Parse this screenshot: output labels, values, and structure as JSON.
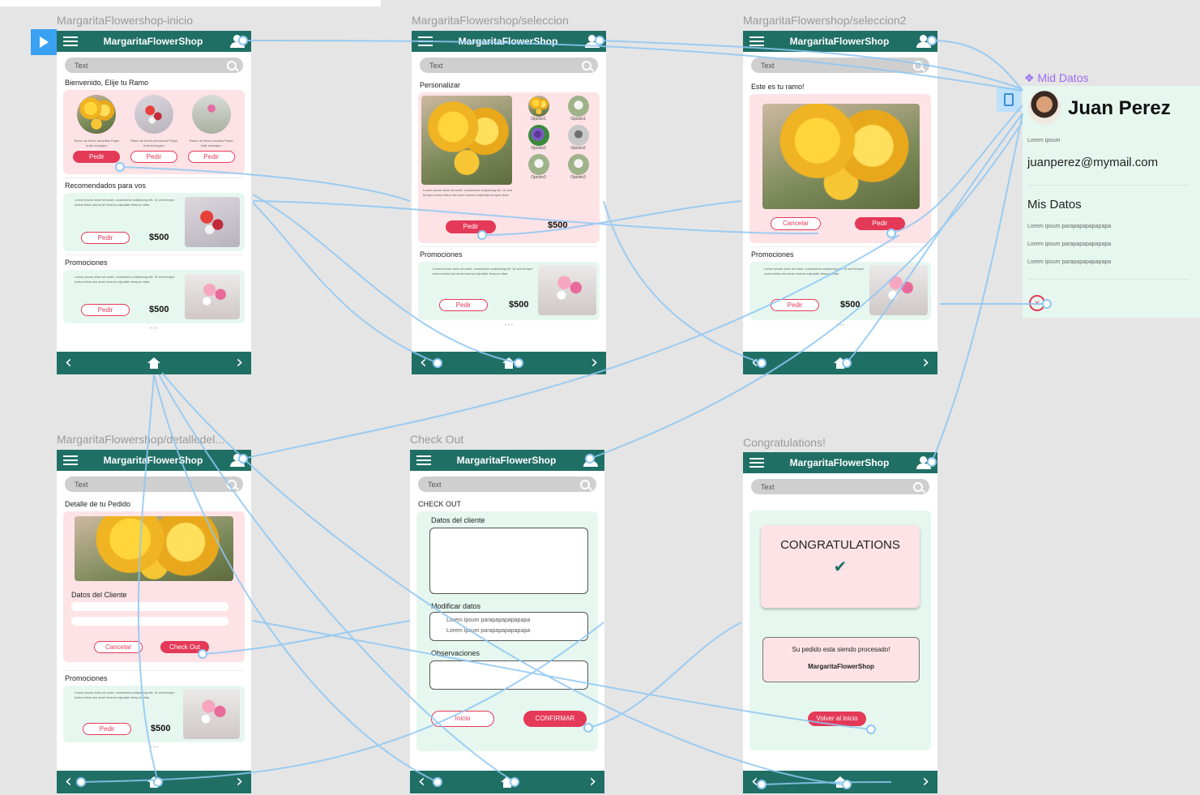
{
  "canvas": {
    "frames": [
      {
        "id": "inicio",
        "title": "MargaritaFlowershop-inicio"
      },
      {
        "id": "seleccion",
        "title": "MargaritaFlowershop/seleccion"
      },
      {
        "id": "seleccion2",
        "title": "MargaritaFlowershop/seleccion2"
      },
      {
        "id": "detalle",
        "title": "MargaritaFlowershop/detalledel..."
      },
      {
        "id": "checkout",
        "title": "Check Out"
      },
      {
        "id": "congrats",
        "title": "Congratulations!"
      }
    ],
    "component_label": "Mid Datos"
  },
  "app": {
    "brand": "MargaritaFlowerShop",
    "search_placeholder": "Text",
    "pedir": "Pedir",
    "price": "$500",
    "lorem_card": "Lorem ipsum dolor sit amet, consectetur adipiscing elit. Ut sed tempor luctus tellus nisl amet viverra vulputate tempus vitae.",
    "promociones": "Promociones"
  },
  "inicio": {
    "welcome": "Bienvenido, Elije tu Ramo",
    "products": [
      {
        "caption": "Ramo de flores amarillas Papel kraft ecologico",
        "button": "Pedir"
      },
      {
        "caption": "Ramo de flores primaveral Papel kraft ecologico",
        "button": "Pedir"
      },
      {
        "caption": "Ramo de flores rosadas Papel kraft ecologico",
        "button": "Pedir"
      }
    ],
    "recommended_title": "Recomendados para vos"
  },
  "seleccion": {
    "title": "Personalizar",
    "options": [
      "Opcion1",
      "Opcion1",
      "Opcion2",
      "Opcion2",
      "Opcion3",
      "Opcion3"
    ],
    "price": "$500"
  },
  "seleccion2": {
    "title": "Este es tu ramo!",
    "cancel": "Cancelar",
    "confirm": "Pedir"
  },
  "detalle": {
    "title": "Detalle de tu Pedido",
    "client_label": "Datos del Cliente",
    "cancel": "Cancelar",
    "checkout": "Check Out"
  },
  "checkout": {
    "title": "CHECK OUT",
    "client_label": "Datos del cliente",
    "modify_label": "Modificar datos",
    "modify_lines": [
      "Lorem ipsum parapapapapapapa",
      "Lorem ipsum parapapapapapapa"
    ],
    "obs_label": "Observaciones",
    "home": "Inicio",
    "confirm": "CONFIRMAR"
  },
  "congrats": {
    "heading": "CONGRATULATIONS",
    "processing": "Su pedido esta siendo procesado!",
    "brand": "MargaritaFlowerShop",
    "back": "Volver al inicio"
  },
  "profile": {
    "name": "Juan Perez",
    "subtitle": "Lorem ipsum",
    "email": "juanperez@mymail.com",
    "section": "Mis Datos",
    "lines": [
      "Lorem ipsum parapapapapapapa",
      "Lorem ipsum parapapapapapapa",
      "Lorem ipsum parapapapapapapa"
    ]
  },
  "colors": {
    "header": "#1f6f65",
    "accent": "#e53958",
    "pink": "#fde3e6",
    "mint": "#e6f7f0",
    "link": "#8fc7f2"
  }
}
